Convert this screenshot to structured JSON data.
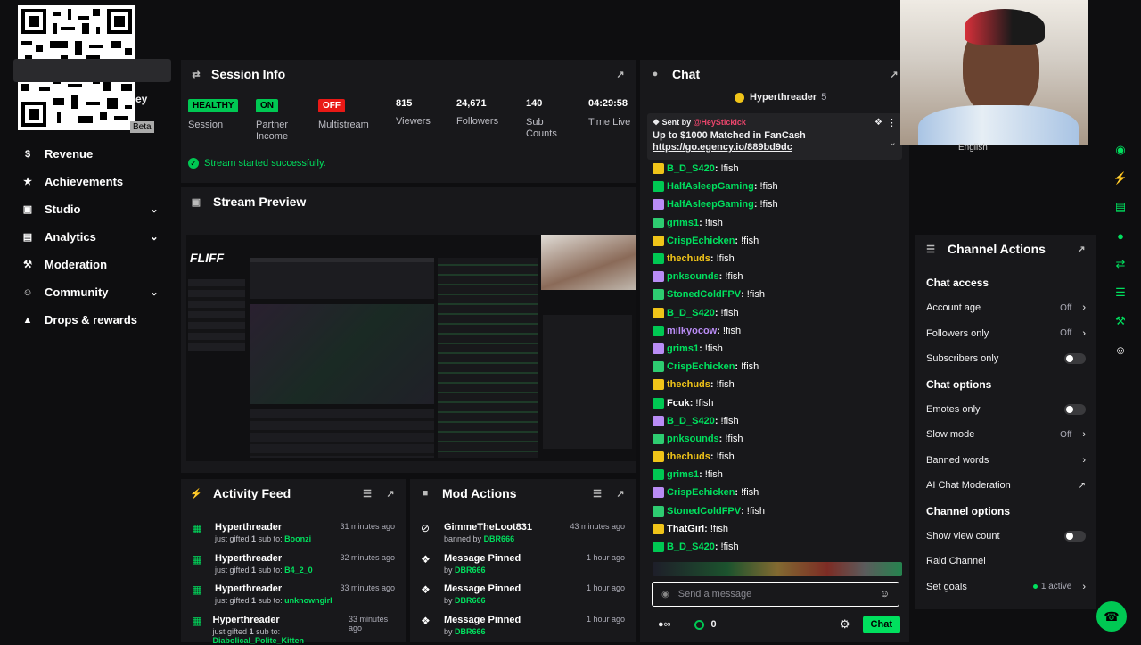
{
  "qr": {
    "label": "QR code"
  },
  "sidebar": {
    "partial_items": [
      "ey",
      "Beta"
    ],
    "items": [
      {
        "label": "Revenue",
        "icon": "dollar-icon",
        "expand": false
      },
      {
        "label": "Achievements",
        "icon": "trophy-icon",
        "expand": false
      },
      {
        "label": "Studio",
        "icon": "monitor-icon",
        "expand": true
      },
      {
        "label": "Analytics",
        "icon": "chart-icon",
        "expand": true
      },
      {
        "label": "Moderation",
        "icon": "wrench-icon",
        "expand": false
      },
      {
        "label": "Community",
        "icon": "people-icon",
        "expand": true
      },
      {
        "label": "Drops & rewards",
        "icon": "gift-icon",
        "expand": false
      }
    ]
  },
  "session": {
    "title": "Session Info",
    "status": [
      {
        "badge": "HEALTHY",
        "color": "#00c853",
        "label": "Session"
      },
      {
        "badge": "ON",
        "color": "#00c853",
        "label": "Partner Income"
      },
      {
        "badge": "OFF",
        "color": "#e91916",
        "label": "Multistream"
      }
    ],
    "stats": [
      {
        "value": "815",
        "label": "Viewers"
      },
      {
        "value": "24,671",
        "label": "Followers"
      },
      {
        "value": "140",
        "label": "Sub Counts"
      },
      {
        "value": "04:29:58",
        "label": "Time Live"
      }
    ],
    "notice": "Stream started successfully."
  },
  "preview": {
    "title": "Stream Preview",
    "logo": "FLIFF"
  },
  "chat": {
    "title": "Chat",
    "top_user": "Hyperthreader",
    "top_count": "5",
    "pinned": {
      "sent_by": "Sent by",
      "sender": "@HeyStickick",
      "text": "Up to $1000 Matched in FanCash",
      "link": "https://go.egency.io/889bd9dc"
    },
    "messages": [
      {
        "user": "B_D_S420",
        "color": "#00e05e",
        "msg": "!fish"
      },
      {
        "user": "HalfAsleepGaming",
        "color": "#00e05e",
        "msg": "!fish"
      },
      {
        "user": "HalfAsleepGaming",
        "color": "#00e05e",
        "msg": "!fish"
      },
      {
        "user": "grims1",
        "color": "#00e05e",
        "msg": "!fish"
      },
      {
        "user": "CrispEchicken",
        "color": "#00e05e",
        "msg": "!fish"
      },
      {
        "user": "thechuds",
        "color": "#f0c419",
        "msg": "!fish"
      },
      {
        "user": "pnksounds",
        "color": "#00e05e",
        "msg": "!fish"
      },
      {
        "user": "StonedColdFPV",
        "color": "#00e05e",
        "msg": "!fish"
      },
      {
        "user": "B_D_S420",
        "color": "#00e05e",
        "msg": "!fish"
      },
      {
        "user": "milkyocow",
        "color": "#b98cf5",
        "msg": "!fish"
      },
      {
        "user": "grims1",
        "color": "#00e05e",
        "msg": "!fish"
      },
      {
        "user": "CrispEchicken",
        "color": "#00e05e",
        "msg": "!fish"
      },
      {
        "user": "thechuds",
        "color": "#f0c419",
        "msg": "!fish"
      },
      {
        "user": "Fcuk",
        "color": "#fff",
        "msg": "!fish"
      },
      {
        "user": "B_D_S420",
        "color": "#00e05e",
        "msg": "!fish"
      },
      {
        "user": "pnksounds",
        "color": "#00e05e",
        "msg": "!fish"
      },
      {
        "user": "thechuds",
        "color": "#f0c419",
        "msg": "!fish"
      },
      {
        "user": "grims1",
        "color": "#00e05e",
        "msg": "!fish"
      },
      {
        "user": "CrispEchicken",
        "color": "#00e05e",
        "msg": "!fish"
      },
      {
        "user": "StonedColdFPV",
        "color": "#00e05e",
        "msg": "!fish"
      },
      {
        "user": "ThatGirl",
        "color": "#fff",
        "msg": "!fish"
      },
      {
        "user": "B_D_S420",
        "color": "#00e05e",
        "msg": "!fish"
      }
    ],
    "input_placeholder": "Send a message",
    "points": "0",
    "send_label": "Chat"
  },
  "webcam": {
    "language": "English"
  },
  "channel_actions": {
    "title": "Channel Actions",
    "sections": [
      {
        "title": "Chat access",
        "rows": [
          {
            "label": "Account age",
            "value": "Off",
            "control": "chevron"
          },
          {
            "label": "Followers only",
            "value": "Off",
            "control": "chevron"
          },
          {
            "label": "Subscribers only",
            "value": "",
            "control": "toggle"
          }
        ]
      },
      {
        "title": "Chat options",
        "rows": [
          {
            "label": "Emotes only",
            "value": "",
            "control": "toggle"
          },
          {
            "label": "Slow mode",
            "value": "Off",
            "control": "chevron"
          },
          {
            "label": "Banned words",
            "value": "",
            "control": "chevron"
          },
          {
            "label": "AI Chat Moderation",
            "value": "",
            "control": "external"
          }
        ]
      },
      {
        "title": "Channel options",
        "rows": [
          {
            "label": "Show view count",
            "value": "",
            "control": "toggle"
          },
          {
            "label": "Raid Channel",
            "value": "",
            "control": "none"
          },
          {
            "label": "Set goals",
            "value": "1 active",
            "control": "chevron"
          }
        ]
      }
    ]
  },
  "activity": {
    "title": "Activity Feed",
    "items": [
      {
        "user": "Hyperthreader",
        "pre": "just gifted",
        "count": "1",
        "mid": "sub to:",
        "target": "Boonzi",
        "time": "31 minutes ago"
      },
      {
        "user": "Hyperthreader",
        "pre": "just gifted",
        "count": "1",
        "mid": "sub to:",
        "target": "B4_2_0",
        "time": "32 minutes ago"
      },
      {
        "user": "Hyperthreader",
        "pre": "just gifted",
        "count": "1",
        "mid": "sub to:",
        "target": "unknowngirl",
        "time": "33 minutes ago"
      },
      {
        "user": "Hyperthreader",
        "pre": "just gifted",
        "count": "1",
        "mid": "sub to:",
        "target": "Diabolical_Polite_Kitten",
        "time": "33 minutes ago"
      }
    ]
  },
  "mod": {
    "title": "Mod Actions",
    "items": [
      {
        "action": "GimmeTheLoot831",
        "by_pre": "banned by",
        "by": "DBR666",
        "time": "43 minutes ago",
        "icon": "ban-icon"
      },
      {
        "action": "Message Pinned",
        "by_pre": "by",
        "by": "DBR666",
        "time": "1 hour ago",
        "icon": "pin-icon"
      },
      {
        "action": "Message Pinned",
        "by_pre": "by",
        "by": "DBR666",
        "time": "1 hour ago",
        "icon": "pin-icon"
      },
      {
        "action": "Message Pinned",
        "by_pre": "by",
        "by": "DBR666",
        "time": "1 hour ago",
        "icon": "pin-icon"
      }
    ]
  },
  "colors": {
    "accent": "#00e05e",
    "bg": "#0e0e10",
    "panel": "#18181b"
  }
}
